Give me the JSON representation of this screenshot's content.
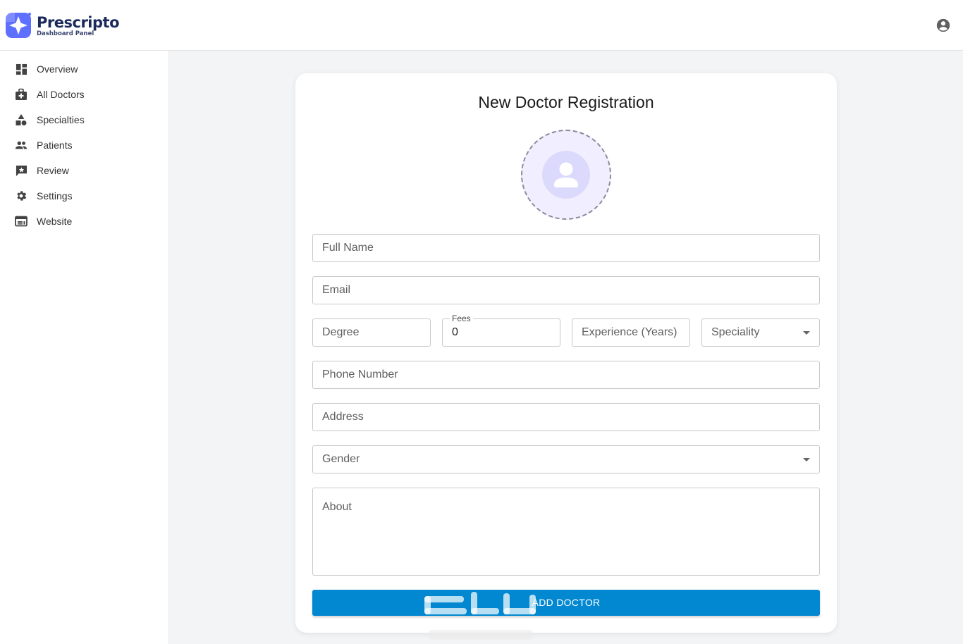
{
  "header": {
    "brand_name": "Prescripto",
    "brand_subtitle": "Dashboard Panel",
    "account_icon": "account-circle-icon"
  },
  "sidebar": {
    "items": [
      {
        "label": "Overview",
        "icon": "dashboard-icon"
      },
      {
        "label": "All Doctors",
        "icon": "medical-bag-icon"
      },
      {
        "label": "Specialties",
        "icon": "shapes-icon"
      },
      {
        "label": "Patients",
        "icon": "people-icon"
      },
      {
        "label": "Review",
        "icon": "rate-review-icon"
      },
      {
        "label": "Settings",
        "icon": "gear-icon"
      },
      {
        "label": "Website",
        "icon": "web-icon"
      }
    ]
  },
  "form": {
    "title": "New Doctor Registration",
    "avatar_icon": "user-avatar-icon",
    "full_name_placeholder": "Full Name",
    "email_placeholder": "Email",
    "degree_placeholder": "Degree",
    "fees_label": "Fees",
    "fees_value": "0",
    "experience_placeholder": "Experience (Years)",
    "speciality_placeholder": "Speciality",
    "phone_placeholder": "Phone Number",
    "address_placeholder": "Address",
    "gender_placeholder": "Gender",
    "about_placeholder": "About",
    "submit_label": "ADD DOCTOR"
  },
  "colors": {
    "brand_navy": "#1b2a5c",
    "brand_purple": "#5f6fff",
    "submit_blue": "#0288d1",
    "avatar_bg": "#f1efff"
  }
}
